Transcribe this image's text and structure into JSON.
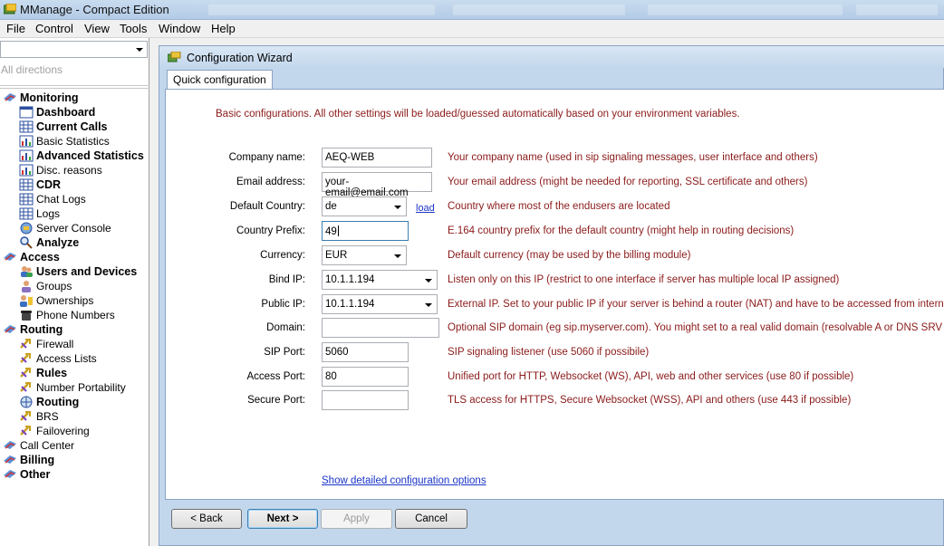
{
  "window": {
    "title": "MManage - Compact Edition"
  },
  "menu": [
    "File",
    "Control",
    "View",
    "Tools",
    "Window",
    "Help"
  ],
  "sidebar": {
    "direction_combo_value": "",
    "direction_placeholder": "All directions",
    "items": [
      {
        "label": "Monitoring",
        "bold": true,
        "level": 0,
        "icon": "monitoring-folder-icon"
      },
      {
        "label": "Dashboard",
        "bold": true,
        "level": 1,
        "icon": "dashboard-window-icon"
      },
      {
        "label": "Current Calls",
        "bold": true,
        "level": 1,
        "icon": "grid-icon"
      },
      {
        "label": "Basic Statistics",
        "bold": false,
        "level": 1,
        "icon": "bar-chart-icon"
      },
      {
        "label": "Advanced Statistics",
        "bold": true,
        "level": 1,
        "icon": "bar-chart-icon"
      },
      {
        "label": "Disc. reasons",
        "bold": false,
        "level": 1,
        "icon": "bar-chart-icon"
      },
      {
        "label": "CDR",
        "bold": true,
        "level": 1,
        "icon": "grid-icon"
      },
      {
        "label": "Chat Logs",
        "bold": false,
        "level": 1,
        "icon": "grid-icon"
      },
      {
        "label": "Logs",
        "bold": false,
        "level": 1,
        "icon": "grid-icon"
      },
      {
        "label": "Server Console",
        "bold": false,
        "level": 1,
        "icon": "console-icon"
      },
      {
        "label": "Analyze",
        "bold": true,
        "level": 1,
        "icon": "magnifier-icon"
      },
      {
        "label": "Access",
        "bold": true,
        "level": 0,
        "icon": "access-folder-icon"
      },
      {
        "label": "Users and Devices",
        "bold": true,
        "level": 1,
        "icon": "users-icon"
      },
      {
        "label": "Groups",
        "bold": false,
        "level": 1,
        "icon": "groups-icon"
      },
      {
        "label": "Ownerships",
        "bold": false,
        "level": 1,
        "icon": "ownership-icon"
      },
      {
        "label": "Phone Numbers",
        "bold": false,
        "level": 1,
        "icon": "phone-icon"
      },
      {
        "label": "Routing",
        "bold": true,
        "level": 0,
        "icon": "routing-folder-icon"
      },
      {
        "label": "Firewall",
        "bold": false,
        "level": 1,
        "icon": "routing-arrow-icon"
      },
      {
        "label": "Access Lists",
        "bold": false,
        "level": 1,
        "icon": "routing-arrow-icon"
      },
      {
        "label": "Rules",
        "bold": true,
        "level": 1,
        "icon": "routing-arrow-icon"
      },
      {
        "label": "Number Portability",
        "bold": false,
        "level": 1,
        "icon": "routing-arrow-icon"
      },
      {
        "label": "Routing",
        "bold": true,
        "level": 1,
        "icon": "globe-icon"
      },
      {
        "label": "BRS",
        "bold": false,
        "level": 1,
        "icon": "routing-arrow-icon"
      },
      {
        "label": "Failovering",
        "bold": false,
        "level": 1,
        "icon": "routing-arrow-icon"
      },
      {
        "label": "Call Center",
        "bold": false,
        "level": 0,
        "icon": "callcenter-folder-icon"
      },
      {
        "label": "Billing",
        "bold": true,
        "level": 0,
        "icon": "billing-folder-icon"
      },
      {
        "label": "Other",
        "bold": true,
        "level": 0,
        "icon": "other-folder-icon"
      }
    ]
  },
  "wizard": {
    "title": "Configuration Wizard",
    "tab": "Quick configuration",
    "intro": "Basic configurations. All other settings will be loaded/guessed automatically based on your environment variables.",
    "fields": [
      {
        "label": "Company name:",
        "value": "AEQ-WEB",
        "type": "text",
        "help": "Your company name (used in sip signaling messages, user interface and others)"
      },
      {
        "label": "Email address:",
        "value": "your-email@email.com",
        "type": "text",
        "help": "Your email address (might be needed for reporting, SSL certificate and others)"
      },
      {
        "label": "Default Country:",
        "value": "de",
        "type": "select",
        "link": "load",
        "help": "Country where most of the endusers are located"
      },
      {
        "label": "Country Prefix:",
        "value": "49",
        "type": "text",
        "focused": true,
        "help": "E.164 country prefix for the default country (might help in routing decisions)"
      },
      {
        "label": "Currency:",
        "value": "EUR",
        "type": "select",
        "help": "Default currency (may be used by the billing module)"
      },
      {
        "label": "Bind IP:",
        "value": "10.1.1.194",
        "type": "select",
        "help": "Listen only on this IP (restrict to one interface if server has multiple local IP assigned)"
      },
      {
        "label": "Public IP:",
        "value": "10.1.1.194",
        "type": "select",
        "help": "External IP. Set to your public IP if your server is behind a router (NAT) and have to be accessed from internet"
      },
      {
        "label": "Domain:",
        "value": "",
        "type": "text",
        "help": "Optional SIP domain (eg sip.myserver.com). You might set to a real valid domain (resolvable A or DNS SRV record)"
      },
      {
        "label": "SIP Port:",
        "value": "5060",
        "type": "text",
        "help": "SIP signaling listener (use 5060 if possibile)"
      },
      {
        "label": "Access Port:",
        "value": "80",
        "type": "text",
        "help": "Unified port for HTTP, Websocket (WS), API, web and other services (use 80 if possible)"
      },
      {
        "label": "Secure Port:",
        "value": "",
        "type": "text",
        "help": "TLS access for HTTPS, Secure Websocket (WSS), API and others (use 443 if possible)"
      }
    ],
    "detail_link": "Show detailed configuration options",
    "buttons": {
      "back": "< Back",
      "next": "Next >",
      "apply": "Apply",
      "cancel": "Cancel"
    }
  }
}
